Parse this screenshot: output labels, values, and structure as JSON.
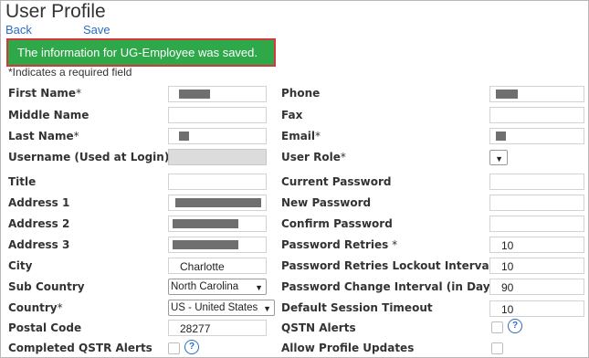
{
  "page": {
    "title": "User Profile",
    "back_label": "Back",
    "save_label": "Save",
    "banner": "The information for UG-Employee was saved.",
    "required_note": "*Indicates a required field"
  },
  "left": {
    "first_name": "First Name",
    "middle_name": "Middle Name",
    "last_name": "Last Name",
    "username": "Username (Used at Login)",
    "title": "Title",
    "address1": "Address 1",
    "address2": "Address 2",
    "address3": "Address 3",
    "city": "City",
    "city_value": "Charlotte",
    "sub_country": "Sub Country",
    "sub_country_value": "North Carolina",
    "country": "Country",
    "country_value": "US - United States",
    "postal_code": "Postal Code",
    "postal_code_value": "28277",
    "completed_qstr_alerts": "Completed QSTR Alerts"
  },
  "right": {
    "phone": "Phone",
    "fax": "Fax",
    "email": "Email",
    "user_role": "User Role",
    "current_password": "Current Password",
    "new_password": "New Password",
    "confirm_password": "Confirm Password",
    "password_retries": "Password Retries",
    "password_retries_value": "10",
    "lockout_interval": "Password Retries Lockout Interval",
    "lockout_interval_value": "10",
    "change_interval": "Password Change Interval (in Days)",
    "change_interval_value": "90",
    "session_timeout": "Default Session Timeout",
    "session_timeout_value": "10",
    "qstn_alerts": "QSTN Alerts",
    "allow_profile_updates": "Allow Profile Updates"
  },
  "icons": {
    "help": "question-mark-circle-icon",
    "dropdown": "chevron-down-icon"
  },
  "colors": {
    "banner_bg": "#2fa84a",
    "banner_border": "#d23a3a",
    "link": "#2a6cc4"
  }
}
